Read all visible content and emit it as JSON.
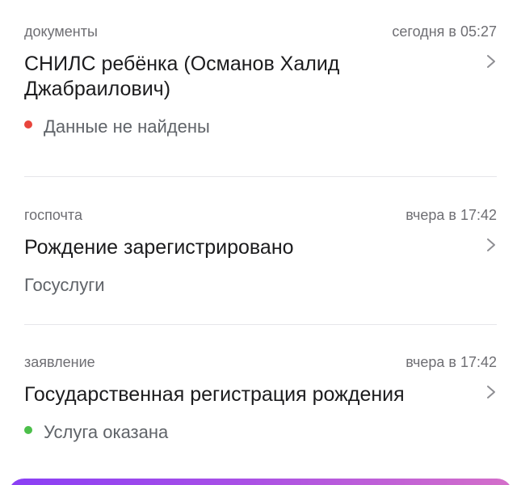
{
  "notifications": [
    {
      "category": "документы",
      "time": "сегодня в 05:27",
      "title": "СНИЛС ребёнка (Османов Халид Джабраилович)",
      "status": "Данные не найдены",
      "status_color": "#e8453c",
      "chevron_icon": "chevron-right-icon"
    },
    {
      "category": "госпочта",
      "time": "вчера в 17:42",
      "title": "Рождение зарегистрировано",
      "status": "Госуслуги",
      "chevron_icon": "chevron-right-icon"
    },
    {
      "category": "заявление",
      "time": "вчера в 17:42",
      "title": "Государственная регистрация рождения",
      "status": "Услуга оказана",
      "status_color": "#4cbf4a",
      "chevron_icon": "chevron-right-icon"
    }
  ],
  "colors": {
    "meta_text": "#6e6e73",
    "title_text": "#1c1c1e",
    "divider": "#e6e6ea",
    "chevron": "#8e8e93",
    "bottom_gradient": [
      "#8a3ff5",
      "#d46fc9"
    ]
  }
}
